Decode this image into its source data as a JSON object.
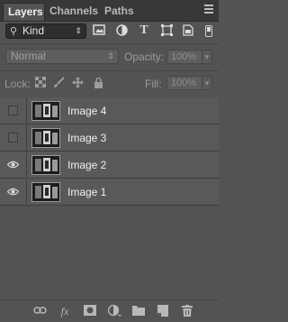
{
  "tabs": [
    {
      "label": "Layers",
      "active": true
    },
    {
      "label": "Channels",
      "active": false
    },
    {
      "label": "Paths",
      "active": false
    }
  ],
  "filter": {
    "kind_label": "Kind",
    "icons": [
      "image-filter-icon",
      "adjustment-filter-icon",
      "type-filter-icon",
      "shape-filter-icon",
      "smart-object-filter-icon"
    ]
  },
  "blend": {
    "mode": "Normal",
    "opacity_label": "Opacity:",
    "opacity_value": "100%"
  },
  "lock": {
    "label": "Lock:",
    "icons": [
      "lock-transparent-pixels-icon",
      "lock-image-pixels-icon",
      "lock-position-icon",
      "lock-all-icon"
    ],
    "fill_label": "Fill:",
    "fill_value": "100%"
  },
  "layers": [
    {
      "name": "Image 4",
      "visible": false
    },
    {
      "name": "Image 3",
      "visible": false
    },
    {
      "name": "Image 2",
      "visible": true
    },
    {
      "name": "Image 1",
      "visible": true
    }
  ],
  "bottom_icons": [
    "link-layers-icon",
    "fx-icon",
    "layer-mask-icon",
    "adjustment-layer-icon",
    "new-group-icon",
    "new-layer-icon",
    "trash-icon"
  ],
  "colors": {
    "panel": "#535353",
    "tabbar": "#383838",
    "row": "#595959"
  }
}
